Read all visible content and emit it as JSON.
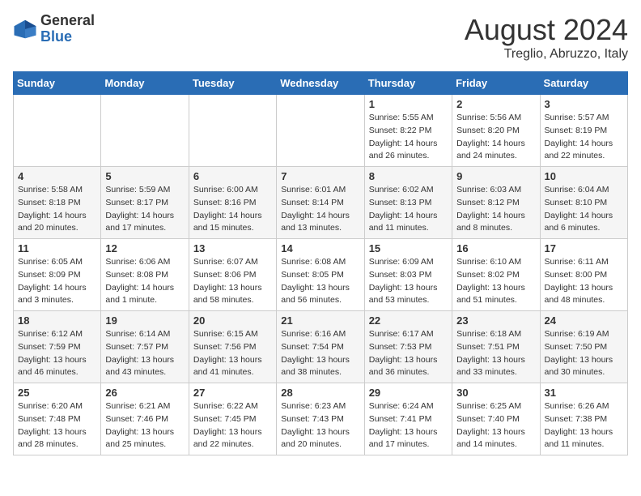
{
  "logo": {
    "general": "General",
    "blue": "Blue"
  },
  "title": "August 2024",
  "location": "Treglio, Abruzzo, Italy",
  "days_of_week": [
    "Sunday",
    "Monday",
    "Tuesday",
    "Wednesday",
    "Thursday",
    "Friday",
    "Saturday"
  ],
  "weeks": [
    [
      {
        "num": "",
        "sunrise": "",
        "sunset": "",
        "daylight": ""
      },
      {
        "num": "",
        "sunrise": "",
        "sunset": "",
        "daylight": ""
      },
      {
        "num": "",
        "sunrise": "",
        "sunset": "",
        "daylight": ""
      },
      {
        "num": "",
        "sunrise": "",
        "sunset": "",
        "daylight": ""
      },
      {
        "num": "1",
        "sunrise": "Sunrise: 5:55 AM",
        "sunset": "Sunset: 8:22 PM",
        "daylight": "Daylight: 14 hours and 26 minutes."
      },
      {
        "num": "2",
        "sunrise": "Sunrise: 5:56 AM",
        "sunset": "Sunset: 8:20 PM",
        "daylight": "Daylight: 14 hours and 24 minutes."
      },
      {
        "num": "3",
        "sunrise": "Sunrise: 5:57 AM",
        "sunset": "Sunset: 8:19 PM",
        "daylight": "Daylight: 14 hours and 22 minutes."
      }
    ],
    [
      {
        "num": "4",
        "sunrise": "Sunrise: 5:58 AM",
        "sunset": "Sunset: 8:18 PM",
        "daylight": "Daylight: 14 hours and 20 minutes."
      },
      {
        "num": "5",
        "sunrise": "Sunrise: 5:59 AM",
        "sunset": "Sunset: 8:17 PM",
        "daylight": "Daylight: 14 hours and 17 minutes."
      },
      {
        "num": "6",
        "sunrise": "Sunrise: 6:00 AM",
        "sunset": "Sunset: 8:16 PM",
        "daylight": "Daylight: 14 hours and 15 minutes."
      },
      {
        "num": "7",
        "sunrise": "Sunrise: 6:01 AM",
        "sunset": "Sunset: 8:14 PM",
        "daylight": "Daylight: 14 hours and 13 minutes."
      },
      {
        "num": "8",
        "sunrise": "Sunrise: 6:02 AM",
        "sunset": "Sunset: 8:13 PM",
        "daylight": "Daylight: 14 hours and 11 minutes."
      },
      {
        "num": "9",
        "sunrise": "Sunrise: 6:03 AM",
        "sunset": "Sunset: 8:12 PM",
        "daylight": "Daylight: 14 hours and 8 minutes."
      },
      {
        "num": "10",
        "sunrise": "Sunrise: 6:04 AM",
        "sunset": "Sunset: 8:10 PM",
        "daylight": "Daylight: 14 hours and 6 minutes."
      }
    ],
    [
      {
        "num": "11",
        "sunrise": "Sunrise: 6:05 AM",
        "sunset": "Sunset: 8:09 PM",
        "daylight": "Daylight: 14 hours and 3 minutes."
      },
      {
        "num": "12",
        "sunrise": "Sunrise: 6:06 AM",
        "sunset": "Sunset: 8:08 PM",
        "daylight": "Daylight: 14 hours and 1 minute."
      },
      {
        "num": "13",
        "sunrise": "Sunrise: 6:07 AM",
        "sunset": "Sunset: 8:06 PM",
        "daylight": "Daylight: 13 hours and 58 minutes."
      },
      {
        "num": "14",
        "sunrise": "Sunrise: 6:08 AM",
        "sunset": "Sunset: 8:05 PM",
        "daylight": "Daylight: 13 hours and 56 minutes."
      },
      {
        "num": "15",
        "sunrise": "Sunrise: 6:09 AM",
        "sunset": "Sunset: 8:03 PM",
        "daylight": "Daylight: 13 hours and 53 minutes."
      },
      {
        "num": "16",
        "sunrise": "Sunrise: 6:10 AM",
        "sunset": "Sunset: 8:02 PM",
        "daylight": "Daylight: 13 hours and 51 minutes."
      },
      {
        "num": "17",
        "sunrise": "Sunrise: 6:11 AM",
        "sunset": "Sunset: 8:00 PM",
        "daylight": "Daylight: 13 hours and 48 minutes."
      }
    ],
    [
      {
        "num": "18",
        "sunrise": "Sunrise: 6:12 AM",
        "sunset": "Sunset: 7:59 PM",
        "daylight": "Daylight: 13 hours and 46 minutes."
      },
      {
        "num": "19",
        "sunrise": "Sunrise: 6:14 AM",
        "sunset": "Sunset: 7:57 PM",
        "daylight": "Daylight: 13 hours and 43 minutes."
      },
      {
        "num": "20",
        "sunrise": "Sunrise: 6:15 AM",
        "sunset": "Sunset: 7:56 PM",
        "daylight": "Daylight: 13 hours and 41 minutes."
      },
      {
        "num": "21",
        "sunrise": "Sunrise: 6:16 AM",
        "sunset": "Sunset: 7:54 PM",
        "daylight": "Daylight: 13 hours and 38 minutes."
      },
      {
        "num": "22",
        "sunrise": "Sunrise: 6:17 AM",
        "sunset": "Sunset: 7:53 PM",
        "daylight": "Daylight: 13 hours and 36 minutes."
      },
      {
        "num": "23",
        "sunrise": "Sunrise: 6:18 AM",
        "sunset": "Sunset: 7:51 PM",
        "daylight": "Daylight: 13 hours and 33 minutes."
      },
      {
        "num": "24",
        "sunrise": "Sunrise: 6:19 AM",
        "sunset": "Sunset: 7:50 PM",
        "daylight": "Daylight: 13 hours and 30 minutes."
      }
    ],
    [
      {
        "num": "25",
        "sunrise": "Sunrise: 6:20 AM",
        "sunset": "Sunset: 7:48 PM",
        "daylight": "Daylight: 13 hours and 28 minutes."
      },
      {
        "num": "26",
        "sunrise": "Sunrise: 6:21 AM",
        "sunset": "Sunset: 7:46 PM",
        "daylight": "Daylight: 13 hours and 25 minutes."
      },
      {
        "num": "27",
        "sunrise": "Sunrise: 6:22 AM",
        "sunset": "Sunset: 7:45 PM",
        "daylight": "Daylight: 13 hours and 22 minutes."
      },
      {
        "num": "28",
        "sunrise": "Sunrise: 6:23 AM",
        "sunset": "Sunset: 7:43 PM",
        "daylight": "Daylight: 13 hours and 20 minutes."
      },
      {
        "num": "29",
        "sunrise": "Sunrise: 6:24 AM",
        "sunset": "Sunset: 7:41 PM",
        "daylight": "Daylight: 13 hours and 17 minutes."
      },
      {
        "num": "30",
        "sunrise": "Sunrise: 6:25 AM",
        "sunset": "Sunset: 7:40 PM",
        "daylight": "Daylight: 13 hours and 14 minutes."
      },
      {
        "num": "31",
        "sunrise": "Sunrise: 6:26 AM",
        "sunset": "Sunset: 7:38 PM",
        "daylight": "Daylight: 13 hours and 11 minutes."
      }
    ]
  ]
}
